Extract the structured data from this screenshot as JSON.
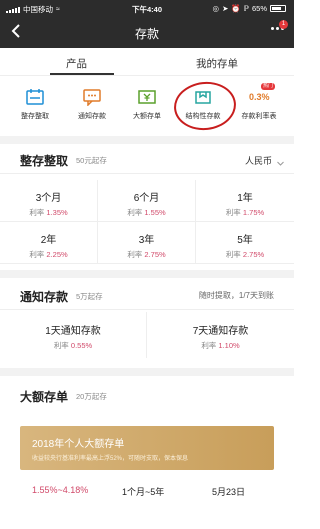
{
  "status_bar": {
    "carrier": "中国移动",
    "time": "下午4:40",
    "battery": "65%"
  },
  "nav": {
    "title": "存款",
    "badge": "1"
  },
  "tabs": [
    {
      "label": "产品",
      "active": true
    },
    {
      "label": "我的存单",
      "active": false
    }
  ],
  "products": [
    {
      "label": "整存整取",
      "icon": "calendar-icon"
    },
    {
      "label": "通知存款",
      "icon": "message-icon"
    },
    {
      "label": "大额存单",
      "icon": "yuan-bill-icon"
    },
    {
      "label": "结构性存款",
      "icon": "bag-icon"
    },
    {
      "label": "存款利率表",
      "icon": "rate-icon",
      "icon_text": "0.3%",
      "hot_badge": "热门"
    }
  ],
  "fixed": {
    "title": "整存整取",
    "min": "50元起存",
    "currency": "人民币",
    "rate_label": "利率",
    "items": [
      {
        "term": "3个月",
        "rate": "1.35%"
      },
      {
        "term": "6个月",
        "rate": "1.55%"
      },
      {
        "term": "1年",
        "rate": "1.75%"
      },
      {
        "term": "2年",
        "rate": "2.25%"
      },
      {
        "term": "3年",
        "rate": "2.75%"
      },
      {
        "term": "5年",
        "rate": "2.75%"
      }
    ]
  },
  "notice": {
    "title": "通知存款",
    "min": "5万起存",
    "note": "随时提取，1/7天到账",
    "rate_label": "利率",
    "items": [
      {
        "term": "1天通知存款",
        "rate": "0.55%"
      },
      {
        "term": "7天通知存款",
        "rate": "1.10%"
      }
    ]
  },
  "large": {
    "title": "大额存单",
    "min": "20万起存",
    "banner_title": "2018年个人大额存单",
    "banner_sub": "收益较央行基准利率最高上浮52%，可随时支取，保本保息",
    "rate_range": "1.55%~4.18%",
    "term_range": "1个月~5年",
    "date": "5月23日"
  },
  "colors": {
    "header_bg": "#2c2c2c",
    "accent_blue": "#1f8fd6",
    "accent_orange": "#e07b2a",
    "accent_green": "#5aa02c",
    "accent_teal": "#27a5a0",
    "rate_red": "#d14a6a",
    "banner_gold": "#c89e5a",
    "annotation_red": "#c81e1e"
  }
}
